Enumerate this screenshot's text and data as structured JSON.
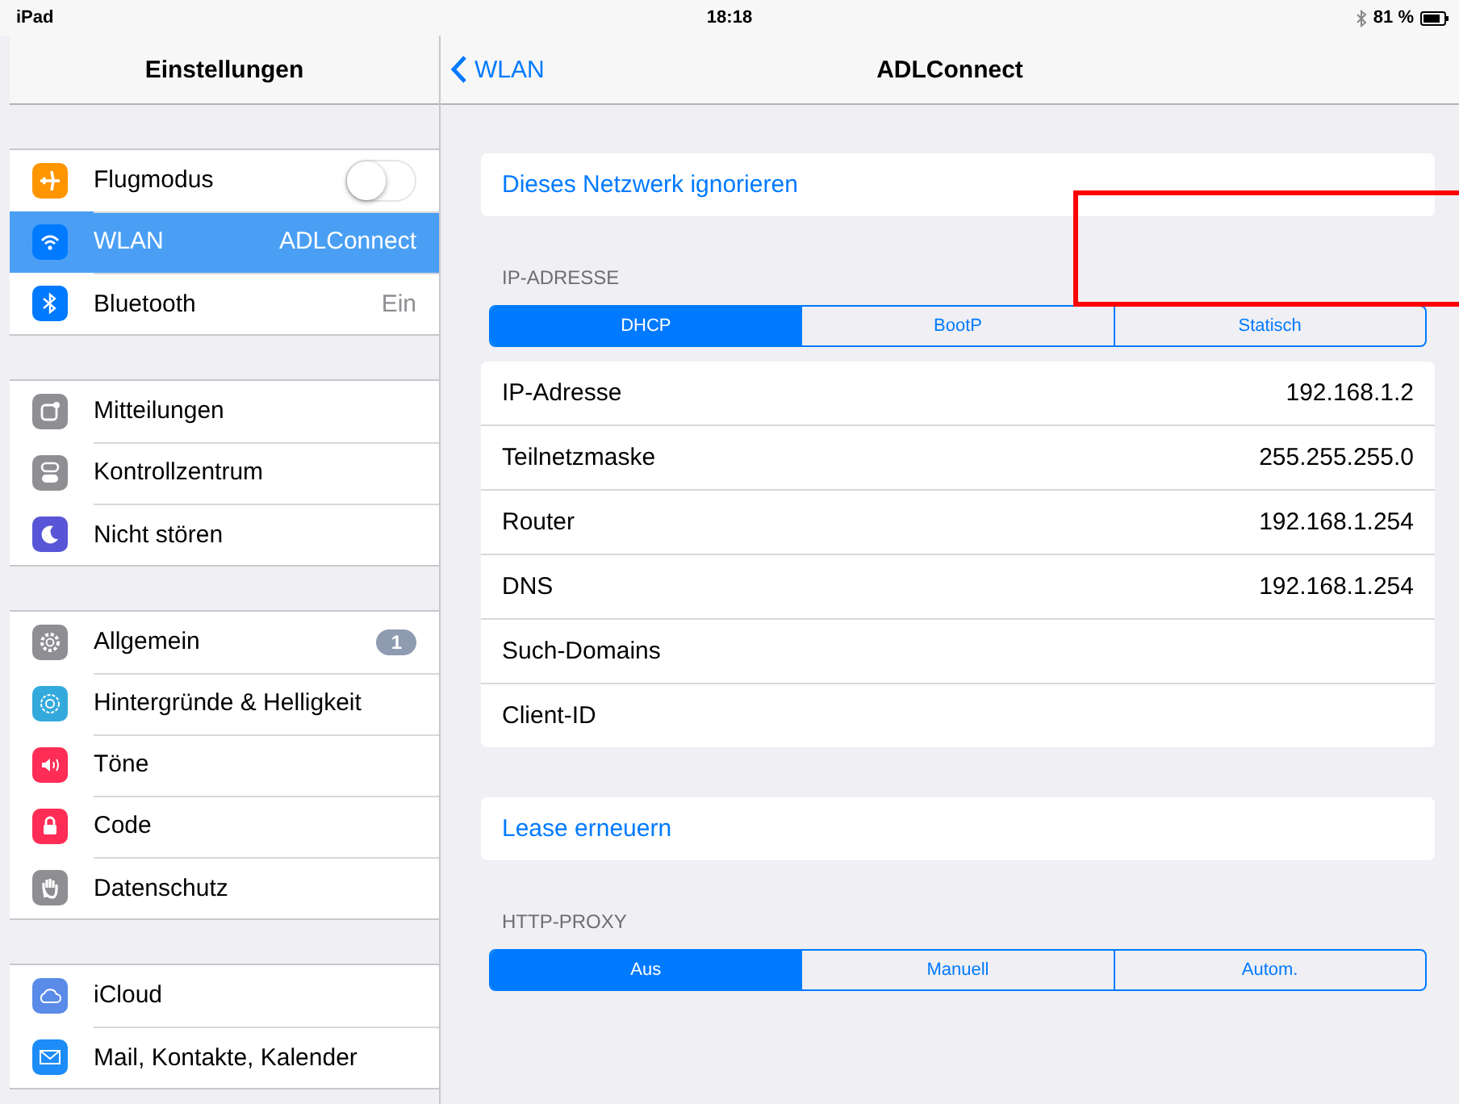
{
  "status_bar": {
    "device": "iPad",
    "time": "18:18",
    "battery": "81 %",
    "bluetooth": true
  },
  "sidebar": {
    "title": "Einstellungen",
    "groups": [
      {
        "items": [
          {
            "label": "Flugmodus",
            "kind": "toggle",
            "on": false,
            "selected": false
          },
          {
            "label": "WLAN",
            "kind": "value",
            "value": "ADLConnect",
            "selected": true
          },
          {
            "label": "Bluetooth",
            "kind": "value",
            "value": "Ein",
            "selected": false
          }
        ]
      },
      {
        "items": [
          {
            "label": "Mitteilungen",
            "kind": "plain",
            "selected": false
          },
          {
            "label": "Kontrollzentrum",
            "kind": "plain",
            "selected": false
          },
          {
            "label": "Nicht stören",
            "kind": "plain",
            "selected": false
          }
        ]
      },
      {
        "items": [
          {
            "label": "Allgemein",
            "kind": "badge",
            "badge": "1",
            "selected": false
          },
          {
            "label": "Hintergründe & Helligkeit",
            "kind": "plain",
            "selected": false
          },
          {
            "label": "Töne",
            "kind": "plain",
            "selected": false
          },
          {
            "label": "Code",
            "kind": "plain",
            "selected": false
          },
          {
            "label": "Datenschutz",
            "kind": "plain",
            "selected": false
          }
        ]
      },
      {
        "items": [
          {
            "label": "iCloud",
            "kind": "plain",
            "selected": false
          },
          {
            "label": "Mail, Kontakte, Kalender",
            "kind": "plain",
            "selected": false
          }
        ]
      }
    ]
  },
  "nav": {
    "back": "WLAN",
    "title": "ADLConnect"
  },
  "content": [
    {
      "kind": "action",
      "label": "Dieses Netzwerk ignorieren"
    },
    {
      "kind": "header",
      "label": "IP-ADRESSE"
    },
    {
      "kind": "segments",
      "segments": [
        {
          "label": "DHCP",
          "selected": true
        },
        {
          "label": "BootP",
          "selected": false
        },
        {
          "label": "Statisch",
          "selected": false
        }
      ]
    },
    {
      "kind": "table",
      "rows": [
        {
          "label": "IP-Adresse",
          "value": "192.168.1.2"
        },
        {
          "label": "Teilnetzmaske",
          "value": "255.255.255.0"
        },
        {
          "label": "Router",
          "value": "192.168.1.254"
        },
        {
          "label": "DNS",
          "value": "192.168.1.254"
        },
        {
          "label": "Such-Domains"
        },
        {
          "label": "Client-ID"
        }
      ]
    },
    {
      "kind": "action",
      "label": "Lease erneuern"
    },
    {
      "kind": "header",
      "label": "HTTP-PROXY"
    },
    {
      "kind": "segments",
      "segments": [
        {
          "label": "Aus",
          "selected": true
        },
        {
          "label": "Manuell",
          "selected": false
        },
        {
          "label": "Autom.",
          "selected": false
        }
      ]
    }
  ],
  "highlight": {
    "kind": "frame"
  }
}
